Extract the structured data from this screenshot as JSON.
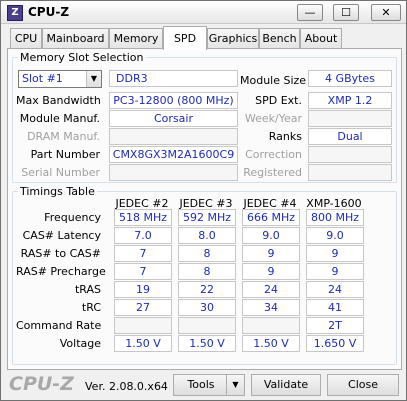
{
  "window": {
    "title": "CPU-Z",
    "icon": "cpu-z-app-icon"
  },
  "titlebar_buttons": {
    "minimize": "—",
    "maximize": "☐",
    "close": "✕"
  },
  "tabs": [
    "CPU",
    "Mainboard",
    "Memory",
    "SPD",
    "Graphics",
    "Bench",
    "About"
  ],
  "active_tab": "SPD",
  "memory_slot": {
    "legend": "Memory Slot Selection",
    "slot_selected": "Slot #1",
    "type": "DDR3",
    "labels": {
      "max_bandwidth": "Max Bandwidth",
      "module_manuf": "Module Manuf.",
      "dram_manuf": "DRAM Manuf.",
      "part_number": "Part Number",
      "serial_number": "Serial Number",
      "module_size": "Module Size",
      "spd_ext": "SPD Ext.",
      "week_year": "Week/Year",
      "ranks": "Ranks",
      "correction": "Correction",
      "registered": "Registered"
    },
    "values": {
      "max_bandwidth": "PC3-12800 (800 MHz)",
      "module_manuf": "Corsair",
      "dram_manuf": "",
      "part_number": "CMX8GX3M2A1600C9",
      "serial_number": "",
      "module_size": "4 GBytes",
      "spd_ext": "XMP 1.2",
      "week_year": "",
      "ranks": "Dual",
      "correction": "",
      "registered": ""
    }
  },
  "timings": {
    "legend": "Timings Table",
    "columns": [
      "JEDEC #2",
      "JEDEC #3",
      "JEDEC #4",
      "XMP-1600"
    ],
    "rows": [
      {
        "label": "Frequency",
        "values": [
          "518 MHz",
          "592 MHz",
          "666 MHz",
          "800 MHz"
        ]
      },
      {
        "label": "CAS# Latency",
        "values": [
          "7.0",
          "8.0",
          "9.0",
          "9.0"
        ]
      },
      {
        "label": "RAS# to CAS#",
        "values": [
          "7",
          "8",
          "9",
          "9"
        ]
      },
      {
        "label": "RAS# Precharge",
        "values": [
          "7",
          "8",
          "9",
          "9"
        ]
      },
      {
        "label": "tRAS",
        "values": [
          "19",
          "22",
          "24",
          "24"
        ]
      },
      {
        "label": "tRC",
        "values": [
          "27",
          "30",
          "34",
          "41"
        ]
      },
      {
        "label": "Command Rate",
        "values": [
          "",
          "",
          "",
          "2T"
        ]
      },
      {
        "label": "Voltage",
        "values": [
          "1.50 V",
          "1.50 V",
          "1.50 V",
          "1.650 V"
        ]
      }
    ]
  },
  "footer": {
    "brand": "CPU-Z",
    "version": "Ver. 2.08.0.x64",
    "tools_label": "Tools",
    "validate_label": "Validate",
    "close_label": "Close"
  },
  "colors": {
    "value_text": "#1d2bb8",
    "dim_label": "#a0a0a0"
  }
}
